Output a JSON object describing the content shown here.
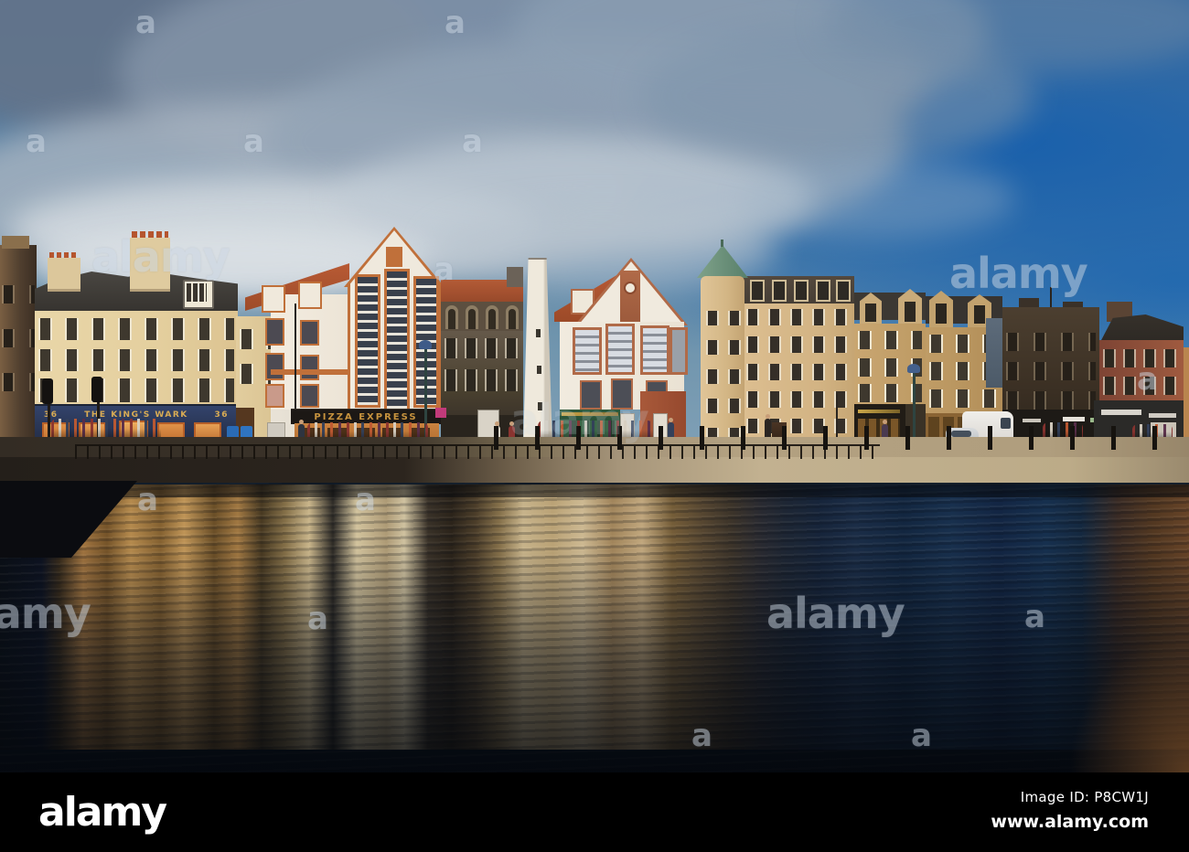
{
  "image": {
    "description": "Evening stock photo of historic quayside buildings and pubs reflected in dark water, blue sky with grey clouds"
  },
  "signs": {
    "kings_wark_left_number": "36",
    "kings_wark_name": "THE KING'S WARK",
    "kings_wark_right_number": "36",
    "pizza_express": "PIZZA EXPRESS"
  },
  "watermark": {
    "brand": "alamy",
    "letter": "a"
  },
  "footer": {
    "logo": "alamy",
    "image_id": "Image ID: P8CW1J",
    "website": "www.alamy.com"
  },
  "colors": {
    "sky_blue": "#1d63ac",
    "cloud_grey": "#8b99ab",
    "water_navy": "#0e1e33",
    "sandstone": "#d9bd92",
    "pub_navy": "#2c3a58",
    "sign_gold": "#d2a44c",
    "trim_orange": "#c0703a",
    "roof_red": "#a85232",
    "copper_green": "#6e927c",
    "watermark_grey": "#cdd8e4"
  }
}
